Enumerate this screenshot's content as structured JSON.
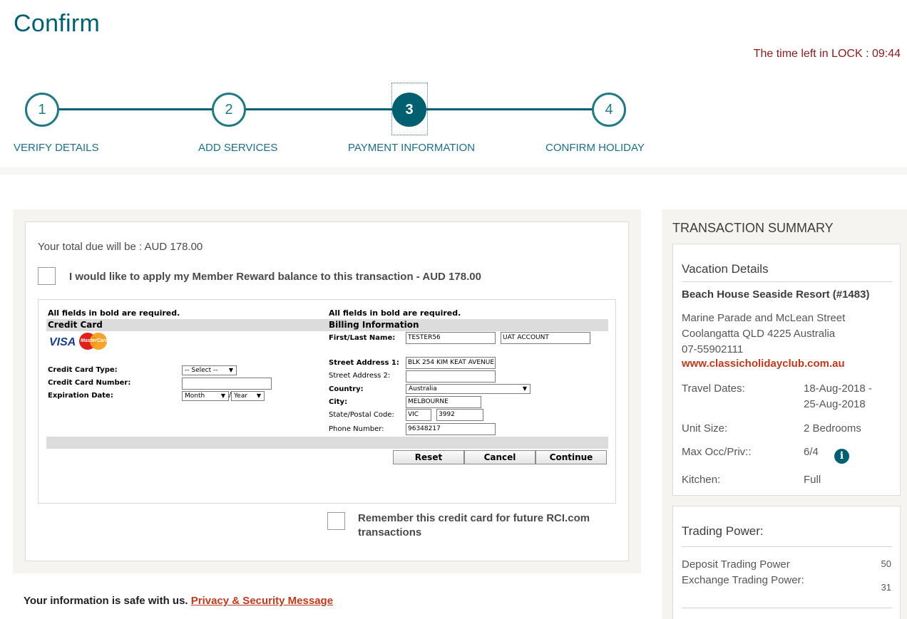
{
  "page": {
    "title": "Confirm",
    "lock_timer": "The time left in LOCK : 09:44"
  },
  "steps": [
    {
      "number": "1",
      "label": "VERIFY DETAILS",
      "active": false
    },
    {
      "number": "2",
      "label": "ADD SERVICES",
      "active": false
    },
    {
      "number": "3",
      "label": "PAYMENT INFORMATION",
      "active": true
    },
    {
      "number": "4",
      "label": "CONFIRM HOLIDAY",
      "active": false
    }
  ],
  "payment": {
    "total_due": "Your total due will be : AUD 178.00",
    "reward_label": "I would like to apply my Member Reward balance to this transaction - AUD 178.00",
    "remember_label": "Remember this credit card for future RCI.com transactions",
    "form": {
      "required_note": "All fields in bold are required.",
      "credit_card": {
        "heading": "Credit Card",
        "visa_logo": "VISA",
        "mastercard_logo": "MasterCard",
        "type_label": "Credit Card Type:",
        "type_value": "-- Select --",
        "number_label": "Credit Card Number:",
        "number_value": "",
        "expiry_label": "Expiration Date:",
        "month_value": "Month",
        "year_value": "Year",
        "separator": "/"
      },
      "billing": {
        "heading": "Billing Information",
        "name_label": "First/Last Name:",
        "first_name": "TESTER56",
        "last_name": "UAT ACCOUNT",
        "street1_label": "Street Address 1:",
        "street1_value": "BLK 254 KIM KEAT AVENUE",
        "street2_label": "Street Address 2:",
        "street2_value": "",
        "country_label": "Country:",
        "country_value": "Australia",
        "city_label": "City:",
        "city_value": "MELBOURNE",
        "state_postal_label": "State/Postal Code:",
        "state_value": "VIC",
        "postal_value": "3992",
        "phone_label": "Phone Number:",
        "phone_value": "96348217"
      },
      "buttons": {
        "reset": "Reset",
        "cancel": "Cancel",
        "continue": "Continue"
      }
    }
  },
  "footer": {
    "safe_text": "Your information is safe with us.",
    "privacy_link": "Privacy & Security Message"
  },
  "summary": {
    "title": "TRANSACTION SUMMARY",
    "vacation": {
      "heading": "Vacation Details",
      "resort": "Beach House Seaside Resort (#1483)",
      "address_line1": "Marine Parade and McLean Street",
      "address_line2": "Coolangatta QLD 4225 Australia",
      "phone": "07-55902111",
      "website": "www.classicholidayclub.com.au",
      "travel_dates_label": "Travel Dates:",
      "travel_dates_line1": "18-Aug-2018 -",
      "travel_dates_line2": "25-Aug-2018",
      "unit_size_label": "Unit Size:",
      "unit_size_value": "2 Bedrooms",
      "max_occ_label": "Max Occ/Priv::",
      "max_occ_value": "6/4",
      "info_icon": "i",
      "kitchen_label": "Kitchen:",
      "kitchen_value": "Full"
    },
    "trading": {
      "heading": "Trading Power:",
      "deposit_label": "Deposit Trading Power",
      "deposit_value": "50",
      "exchange_label": "Exchange Trading Power:",
      "exchange_value": "31"
    }
  },
  "colors": {
    "brand_teal": "#00606f",
    "link_red": "#c0391b",
    "timer_red": "#8b1a1a"
  }
}
